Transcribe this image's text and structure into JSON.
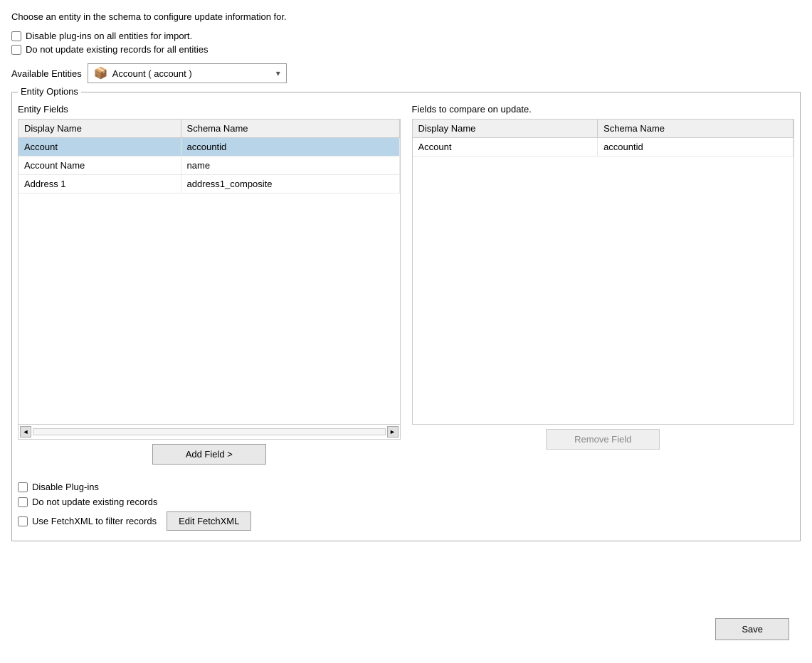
{
  "intro": {
    "text": "Choose an entity in the schema to configure update information for."
  },
  "global_options": {
    "disable_plugins_label": "Disable plug-ins on all entities for import.",
    "do_not_update_label": "Do not update existing records for all entities"
  },
  "available_entities": {
    "label": "Available Entities",
    "selected": "Account  (  account  )",
    "icon": "📦"
  },
  "entity_options": {
    "legend": "Entity Options",
    "left_panel": {
      "title": "Entity Fields",
      "columns": [
        "Display Name",
        "Schema Name"
      ],
      "rows": [
        {
          "display_name": "Account",
          "schema_name": "accountid",
          "selected": true
        },
        {
          "display_name": "Account Name",
          "schema_name": "name",
          "selected": false
        },
        {
          "display_name": "Address 1",
          "schema_name": "address1_composite",
          "selected": false
        }
      ]
    },
    "right_panel": {
      "title": "Fields to compare on update.",
      "columns": [
        "Display Name",
        "Schema Name"
      ],
      "rows": [
        {
          "display_name": "Account",
          "schema_name": "accountid"
        }
      ]
    },
    "add_field_label": "Add Field >",
    "remove_field_label": "Remove Field"
  },
  "bottom_options": {
    "disable_plugins_label": "Disable Plug-ins",
    "do_not_update_label": "Do not update existing records",
    "use_fetchxml_label": "Use FetchXML to filter records",
    "edit_fetchxml_label": "Edit FetchXML"
  },
  "footer": {
    "save_label": "Save"
  }
}
